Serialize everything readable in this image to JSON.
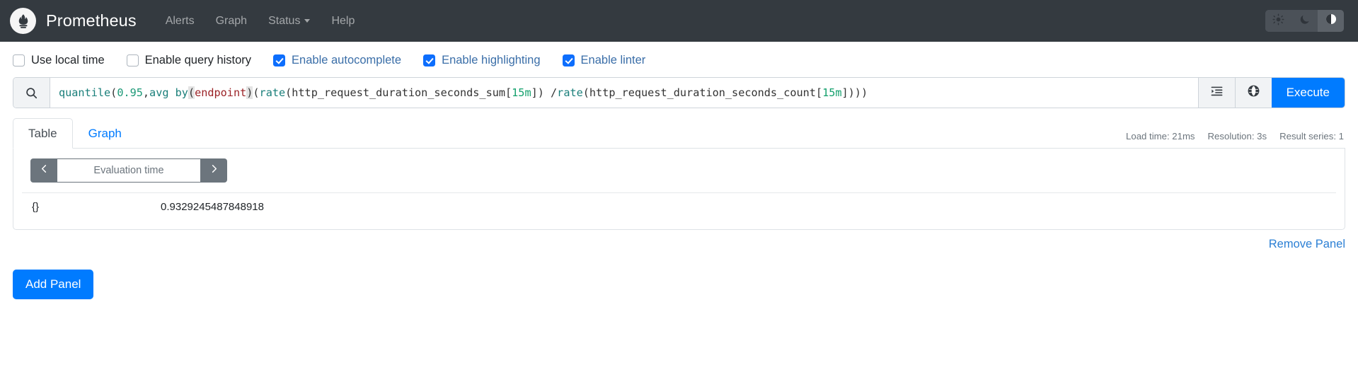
{
  "navbar": {
    "logo_icon": "prometheus-flame-logo",
    "brand": "Prometheus",
    "links": [
      {
        "label": "Alerts",
        "has_caret": false
      },
      {
        "label": "Graph",
        "has_caret": false
      },
      {
        "label": "Status",
        "has_caret": true
      },
      {
        "label": "Help",
        "has_caret": false
      }
    ],
    "theme_buttons": [
      {
        "icon": "sun-icon",
        "name": "light-theme",
        "active": false
      },
      {
        "icon": "moon-icon",
        "name": "dark-theme",
        "active": false
      },
      {
        "icon": "half-circle-icon",
        "name": "auto-theme",
        "active": true
      }
    ]
  },
  "options": [
    {
      "label": "Use local time",
      "checked": false
    },
    {
      "label": "Enable query history",
      "checked": false
    },
    {
      "label": "Enable autocomplete",
      "checked": true
    },
    {
      "label": "Enable highlighting",
      "checked": true
    },
    {
      "label": "Enable linter",
      "checked": true
    }
  ],
  "query": {
    "search_icon": "search-icon",
    "expression": "quantile(0.95, avg by (endpoint) (rate(http_request_duration_seconds_sum[15m]) / rate(http_request_duration_seconds_count[15m])))",
    "tokens": [
      {
        "t": "quantile",
        "c": "fn"
      },
      {
        "t": "(",
        "c": "plain"
      },
      {
        "t": "0.95",
        "c": "num"
      },
      {
        "t": ", ",
        "c": "plain"
      },
      {
        "t": "avg by ",
        "c": "fn"
      },
      {
        "t": "(",
        "c": "paren-hl"
      },
      {
        "t": "endpoint",
        "c": "label"
      },
      {
        "t": ")",
        "c": "paren-hl"
      },
      {
        "t": " (",
        "c": "plain"
      },
      {
        "t": "rate",
        "c": "fn"
      },
      {
        "t": "(http_request_duration_seconds_sum[",
        "c": "plain"
      },
      {
        "t": "15m",
        "c": "dur"
      },
      {
        "t": "]) / ",
        "c": "plain"
      },
      {
        "t": "rate",
        "c": "fn"
      },
      {
        "t": "(http_request_duration_seconds_count[",
        "c": "plain"
      },
      {
        "t": "15m",
        "c": "dur"
      },
      {
        "t": "])))",
        "c": "plain"
      }
    ],
    "format_icon": "format-indent-icon",
    "globe_icon": "globe-icon",
    "execute_label": "Execute"
  },
  "tabs": [
    {
      "label": "Table",
      "active": true
    },
    {
      "label": "Graph",
      "active": false
    }
  ],
  "stats": {
    "load_time": "Load time: 21ms",
    "resolution": "Resolution: 3s",
    "result_series": "Result series: 1"
  },
  "evaluation": {
    "prev_icon": "chevron-left-icon",
    "next_icon": "chevron-right-icon",
    "placeholder": "Evaluation time",
    "value": ""
  },
  "table": {
    "rows": [
      {
        "key": "{}",
        "value": "0.9329245487848918"
      }
    ]
  },
  "footer": {
    "remove_panel": "Remove Panel",
    "add_panel": "Add Panel"
  },
  "colors": {
    "navbar_bg": "#343a40",
    "accent_blue": "#007bff",
    "checkbox_blue": "#0d6efd",
    "muted": "#6c757d"
  }
}
